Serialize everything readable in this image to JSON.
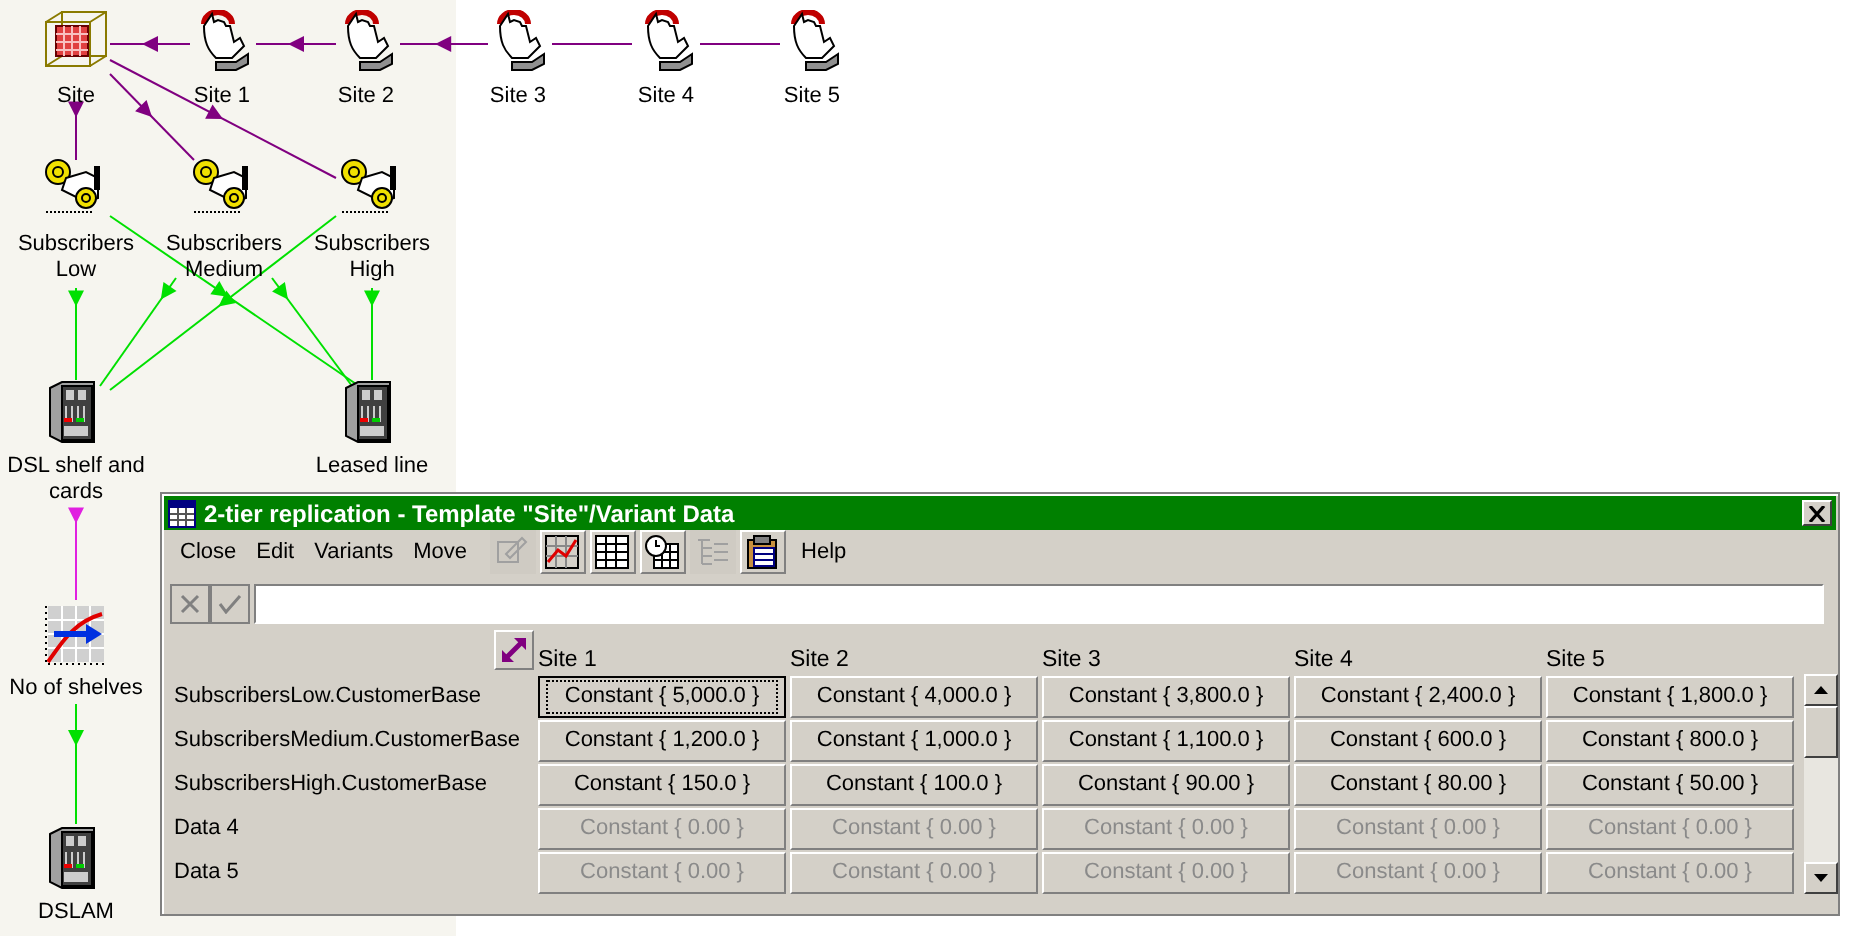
{
  "diagram": {
    "nodes": [
      {
        "kind": "template",
        "label": [
          "Site"
        ]
      },
      {
        "kind": "site",
        "label": [
          "Site 1"
        ]
      },
      {
        "kind": "site",
        "label": [
          "Site 2"
        ]
      },
      {
        "kind": "site",
        "label": [
          "Site 3"
        ]
      },
      {
        "kind": "site",
        "label": [
          "Site 4"
        ]
      },
      {
        "kind": "site",
        "label": [
          "Site 5"
        ]
      },
      {
        "kind": "subscriber",
        "label": [
          "Subscribers",
          "Low"
        ]
      },
      {
        "kind": "subscriber",
        "label": [
          "Subscribers",
          "Medium"
        ]
      },
      {
        "kind": "subscriber",
        "label": [
          "Subscribers",
          "High"
        ]
      },
      {
        "kind": "equipment",
        "label": [
          "DSL shelf and",
          "cards"
        ]
      },
      {
        "kind": "equipment",
        "label": [
          "Leased line"
        ]
      },
      {
        "kind": "chart",
        "label": [
          "No of shelves"
        ]
      },
      {
        "kind": "equipment",
        "label": [
          "DSLAM"
        ]
      }
    ]
  },
  "window": {
    "title": "2-tier replication - Template \"Site\"/Variant Data",
    "menu": [
      "Close",
      "Edit",
      "Variants",
      "Move"
    ],
    "toolbar": [
      {
        "kind": "edit",
        "disabled": true
      },
      {
        "kind": "chart",
        "disabled": false
      },
      {
        "kind": "table",
        "disabled": false
      },
      {
        "kind": "clock-table",
        "disabled": false
      },
      {
        "kind": "tree",
        "disabled": true
      },
      {
        "kind": "clipboard",
        "disabled": false
      }
    ],
    "help_menu": "Help",
    "columns": [
      "Site 1",
      "Site 2",
      "Site 3",
      "Site 4",
      "Site 5"
    ],
    "rows": [
      {
        "label": "SubscribersLow.CustomerBase",
        "cells": [
          {
            "text": "Constant { 5,000.0 }",
            "disabled": false,
            "focused": true
          },
          {
            "text": "Constant { 4,000.0 }",
            "disabled": false,
            "focused": false
          },
          {
            "text": "Constant { 3,800.0 }",
            "disabled": false,
            "focused": false
          },
          {
            "text": "Constant { 2,400.0 }",
            "disabled": false,
            "focused": false
          },
          {
            "text": "Constant { 1,800.0 }",
            "disabled": false,
            "focused": false
          }
        ]
      },
      {
        "label": "SubscribersMedium.CustomerBase",
        "cells": [
          {
            "text": "Constant { 1,200.0 }",
            "disabled": false,
            "focused": false
          },
          {
            "text": "Constant { 1,000.0 }",
            "disabled": false,
            "focused": false
          },
          {
            "text": "Constant { 1,100.0 }",
            "disabled": false,
            "focused": false
          },
          {
            "text": "Constant { 600.0 }",
            "disabled": false,
            "focused": false
          },
          {
            "text": "Constant { 800.0 }",
            "disabled": false,
            "focused": false
          }
        ]
      },
      {
        "label": "SubscribersHigh.CustomerBase",
        "cells": [
          {
            "text": "Constant { 150.0 }",
            "disabled": false,
            "focused": false
          },
          {
            "text": "Constant { 100.0 }",
            "disabled": false,
            "focused": false
          },
          {
            "text": "Constant { 90.00 }",
            "disabled": false,
            "focused": false
          },
          {
            "text": "Constant { 80.00 }",
            "disabled": false,
            "focused": false
          },
          {
            "text": "Constant { 50.00 }",
            "disabled": false,
            "focused": false
          }
        ]
      },
      {
        "label": "Data 4",
        "cells": [
          {
            "text": "Constant { 0.00 }",
            "disabled": true,
            "focused": false
          },
          {
            "text": "Constant { 0.00 }",
            "disabled": true,
            "focused": false
          },
          {
            "text": "Constant { 0.00 }",
            "disabled": true,
            "focused": false
          },
          {
            "text": "Constant { 0.00 }",
            "disabled": true,
            "focused": false
          },
          {
            "text": "Constant { 0.00 }",
            "disabled": true,
            "focused": false
          }
        ]
      },
      {
        "label": "Data 5",
        "cells": [
          {
            "text": "Constant { 0.00 }",
            "disabled": true,
            "focused": false
          },
          {
            "text": "Constant { 0.00 }",
            "disabled": true,
            "focused": false
          },
          {
            "text": "Constant { 0.00 }",
            "disabled": true,
            "focused": false
          },
          {
            "text": "Constant { 0.00 }",
            "disabled": true,
            "focused": false
          },
          {
            "text": "Constant { 0.00 }",
            "disabled": true,
            "focused": false
          }
        ]
      }
    ]
  }
}
